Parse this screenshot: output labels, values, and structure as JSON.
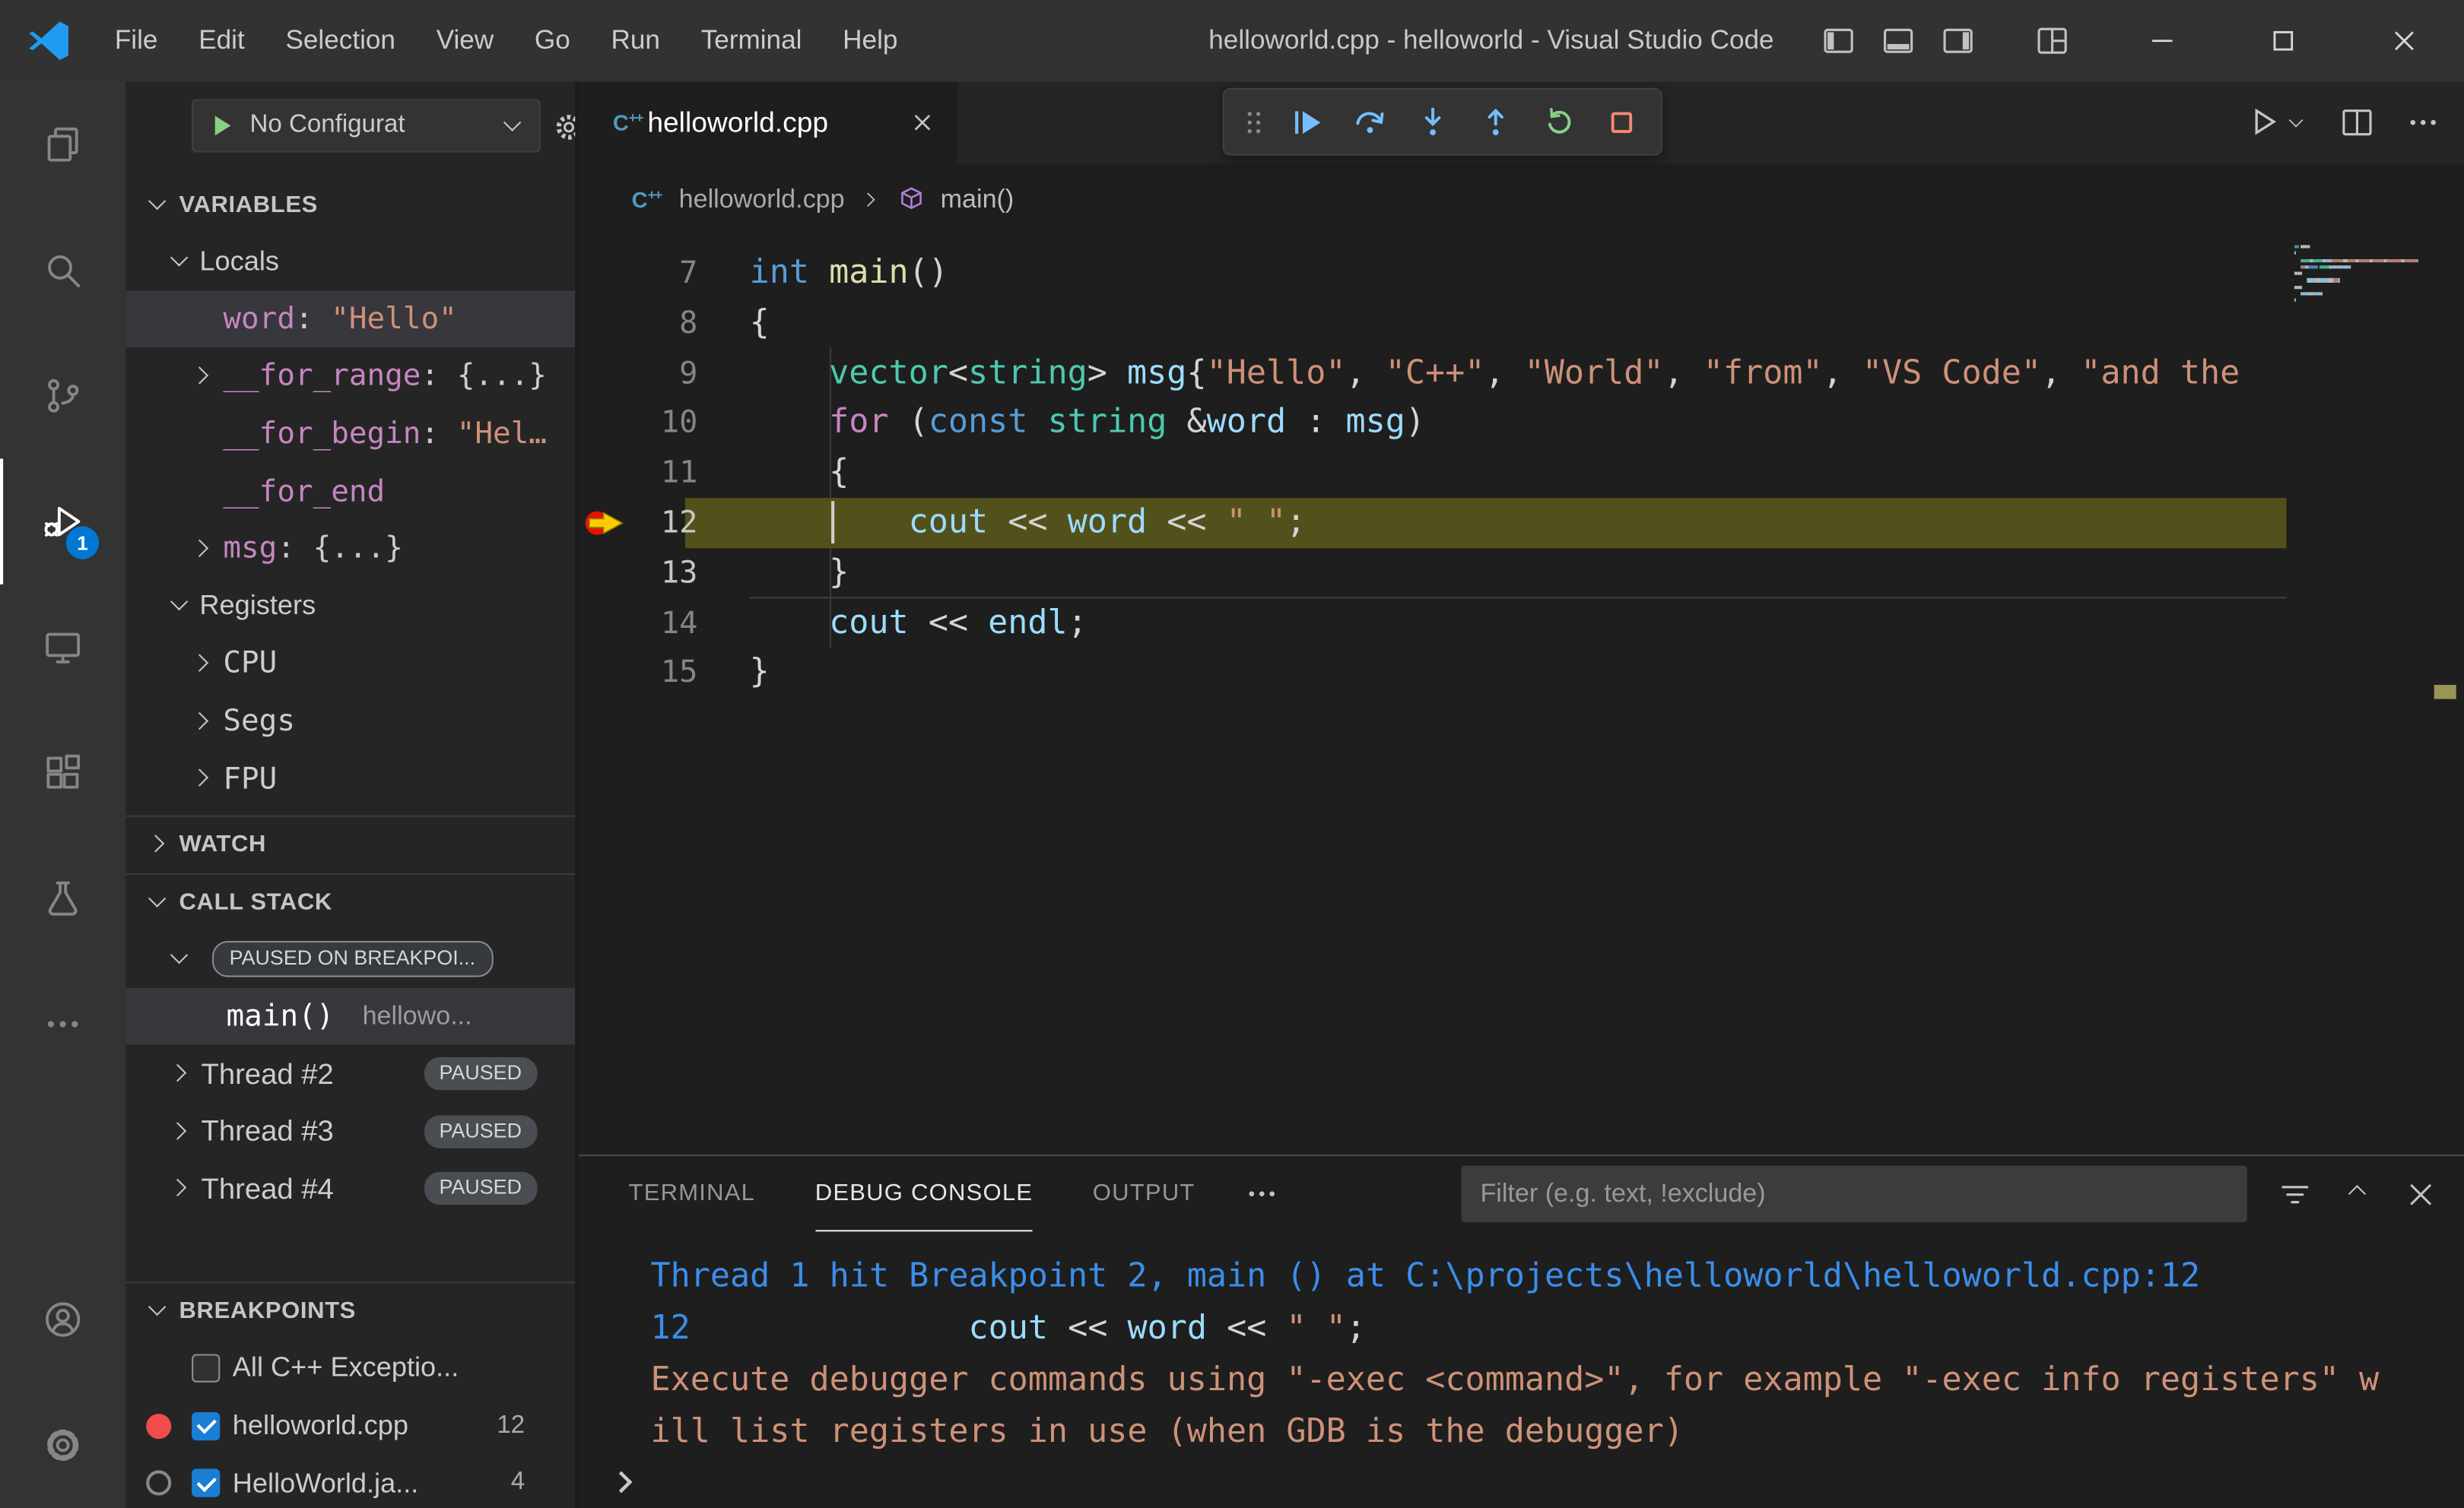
{
  "title_bar": {
    "title": "helloworld.cpp - helloworld - Visual Studio Code",
    "menus": [
      "File",
      "Edit",
      "Selection",
      "View",
      "Go",
      "Run",
      "Terminal",
      "Help"
    ]
  },
  "activity_bar": {
    "debug_badge": "1"
  },
  "sidebar": {
    "config_label": "No Configurat",
    "variables": {
      "label": "VARIABLES",
      "locals_label": "Locals",
      "locals": [
        {
          "selected": true,
          "chevron": "none",
          "tokens": [
            {
              "c": "vname",
              "t": "word"
            },
            {
              "c": "plain",
              "t": ": "
            },
            {
              "c": "str",
              "t": "\"Hello\""
            }
          ]
        },
        {
          "chevron": "right",
          "tokens": [
            {
              "c": "vname",
              "t": "__for_range"
            },
            {
              "c": "plain",
              "t": ": "
            },
            {
              "c": "plain",
              "t": "{...}"
            }
          ]
        },
        {
          "chevron": "none",
          "tokens": [
            {
              "c": "vname",
              "t": "__for_begin"
            },
            {
              "c": "plain",
              "t": ": "
            },
            {
              "c": "str",
              "t": "\"Hel…"
            }
          ]
        },
        {
          "chevron": "none",
          "tokens": [
            {
              "c": "vname",
              "t": "__for_end"
            }
          ]
        },
        {
          "chevron": "right",
          "tokens": [
            {
              "c": "vname",
              "t": "msg"
            },
            {
              "c": "plain",
              "t": ": "
            },
            {
              "c": "plain",
              "t": "{...}"
            }
          ]
        }
      ],
      "registers_label": "Registers",
      "registers": [
        "CPU",
        "Segs",
        "FPU"
      ]
    },
    "watch": {
      "label": "WATCH"
    },
    "call_stack": {
      "label": "CALL STACK",
      "paused_badge": "PAUSED ON BREAKPOI...",
      "frame": {
        "name": "main()",
        "file": "hellowo..."
      },
      "threads": [
        {
          "name": "Thread #2",
          "status": "PAUSED"
        },
        {
          "name": "Thread #3",
          "status": "PAUSED"
        },
        {
          "name": "Thread #4",
          "status": "PAUSED"
        }
      ]
    },
    "breakpoints": {
      "label": "BREAKPOINTS",
      "items": [
        {
          "dot": "none",
          "checked": false,
          "label": "All C++ Exceptio...",
          "count": ""
        },
        {
          "dot": "red",
          "checked": true,
          "label": "helloworld.cpp",
          "count": "12"
        },
        {
          "dot": "gray",
          "checked": true,
          "label": "HelloWorld.ja...",
          "count": "4"
        }
      ]
    }
  },
  "editor": {
    "tab_label": "helloworld.cpp",
    "breadcrumb": {
      "file": "helloworld.cpp",
      "symbol": "main()"
    },
    "code_lines": [
      {
        "num": "7",
        "tokens": [
          {
            "c": "kw",
            "t": "int"
          },
          {
            "c": "pun",
            "t": " "
          },
          {
            "c": "fn",
            "t": "main"
          },
          {
            "c": "pun",
            "t": "()"
          }
        ]
      },
      {
        "num": "8",
        "tokens": [
          {
            "c": "pun",
            "t": "{"
          }
        ]
      },
      {
        "num": "9",
        "tokens": [
          {
            "c": "pun",
            "t": "    "
          },
          {
            "c": "type",
            "t": "vector"
          },
          {
            "c": "pun",
            "t": "<"
          },
          {
            "c": "type",
            "t": "string"
          },
          {
            "c": "pun",
            "t": "> "
          },
          {
            "c": "var",
            "t": "msg"
          },
          {
            "c": "pun",
            "t": "{"
          },
          {
            "c": "str",
            "t": "\"Hello\""
          },
          {
            "c": "pun",
            "t": ", "
          },
          {
            "c": "str",
            "t": "\"C++\""
          },
          {
            "c": "pun",
            "t": ", "
          },
          {
            "c": "str",
            "t": "\"World\""
          },
          {
            "c": "pun",
            "t": ", "
          },
          {
            "c": "str",
            "t": "\"from\""
          },
          {
            "c": "pun",
            "t": ", "
          },
          {
            "c": "str",
            "t": "\"VS Code\""
          },
          {
            "c": "pun",
            "t": ", "
          },
          {
            "c": "str",
            "t": "\"and the"
          }
        ]
      },
      {
        "num": "10",
        "tokens": [
          {
            "c": "pun",
            "t": "    "
          },
          {
            "c": "ctrl",
            "t": "for"
          },
          {
            "c": "pun",
            "t": " ("
          },
          {
            "c": "kw",
            "t": "const"
          },
          {
            "c": "pun",
            "t": " "
          },
          {
            "c": "type",
            "t": "string"
          },
          {
            "c": "pun",
            "t": " &"
          },
          {
            "c": "var",
            "t": "word"
          },
          {
            "c": "pun",
            "t": " : "
          },
          {
            "c": "var",
            "t": "msg"
          },
          {
            "c": "pun",
            "t": ")"
          }
        ]
      },
      {
        "num": "11",
        "tokens": [
          {
            "c": "pun",
            "t": "    {"
          }
        ]
      },
      {
        "num": "12",
        "current": true,
        "breakpoint": true,
        "cursor": true,
        "tokens": [
          {
            "c": "pun",
            "t": "        "
          },
          {
            "c": "var",
            "t": "cout"
          },
          {
            "c": "pun",
            "t": " << "
          },
          {
            "c": "var",
            "t": "word"
          },
          {
            "c": "pun",
            "t": " << "
          },
          {
            "c": "str",
            "t": "\" \""
          },
          {
            "c": "pun",
            "t": ";"
          }
        ]
      },
      {
        "num": "13",
        "rule": true,
        "tokens": [
          {
            "c": "pun",
            "t": "    }"
          }
        ]
      },
      {
        "num": "14",
        "tokens": [
          {
            "c": "pun",
            "t": "    "
          },
          {
            "c": "var",
            "t": "cout"
          },
          {
            "c": "pun",
            "t": " << "
          },
          {
            "c": "var",
            "t": "endl"
          },
          {
            "c": "pun",
            "t": ";"
          }
        ]
      },
      {
        "num": "15",
        "tokens": [
          {
            "c": "pun",
            "t": "}"
          }
        ]
      }
    ]
  },
  "panel": {
    "tabs": [
      {
        "label": "TERMINAL",
        "active": false
      },
      {
        "label": "DEBUG CONSOLE",
        "active": true
      },
      {
        "label": "OUTPUT",
        "active": false
      }
    ],
    "filter_placeholder": "Filter (e.g. text, !exclude)",
    "console_lines": [
      {
        "tokens": [
          {
            "c": "info",
            "t": "Thread 1 hit Breakpoint 2, main () at C:\\projects\\helloworld\\helloworld.cpp:12"
          }
        ]
      },
      {
        "tokens": [
          {
            "c": "info",
            "t": "12"
          },
          {
            "c": "pun",
            "t": "              "
          },
          {
            "c": "var",
            "t": "cout"
          },
          {
            "c": "pun",
            "t": " << "
          },
          {
            "c": "var",
            "t": "word"
          },
          {
            "c": "pun",
            "t": " << "
          },
          {
            "c": "str",
            "t": "\" \""
          },
          {
            "c": "pun",
            "t": ";"
          }
        ]
      },
      {
        "tokens": [
          {
            "c": "str",
            "t": "Execute debugger commands using \"-exec <command>\", for example \"-exec info registers\" w"
          }
        ]
      },
      {
        "tokens": [
          {
            "c": "str",
            "t": "ill list registers in use (when GDB is the debugger)"
          }
        ]
      }
    ]
  },
  "colors": {
    "accent_badge_blue": "#0078d4",
    "debug_icon_blue": "#75beff",
    "restart_green": "#89d185",
    "stop_red": "#f48771",
    "breakpoint_red": "#f14c4c",
    "current_line_highlight": "#53511b",
    "console_info_blue": "#3b8eea",
    "string_orange": "#ce9178"
  }
}
